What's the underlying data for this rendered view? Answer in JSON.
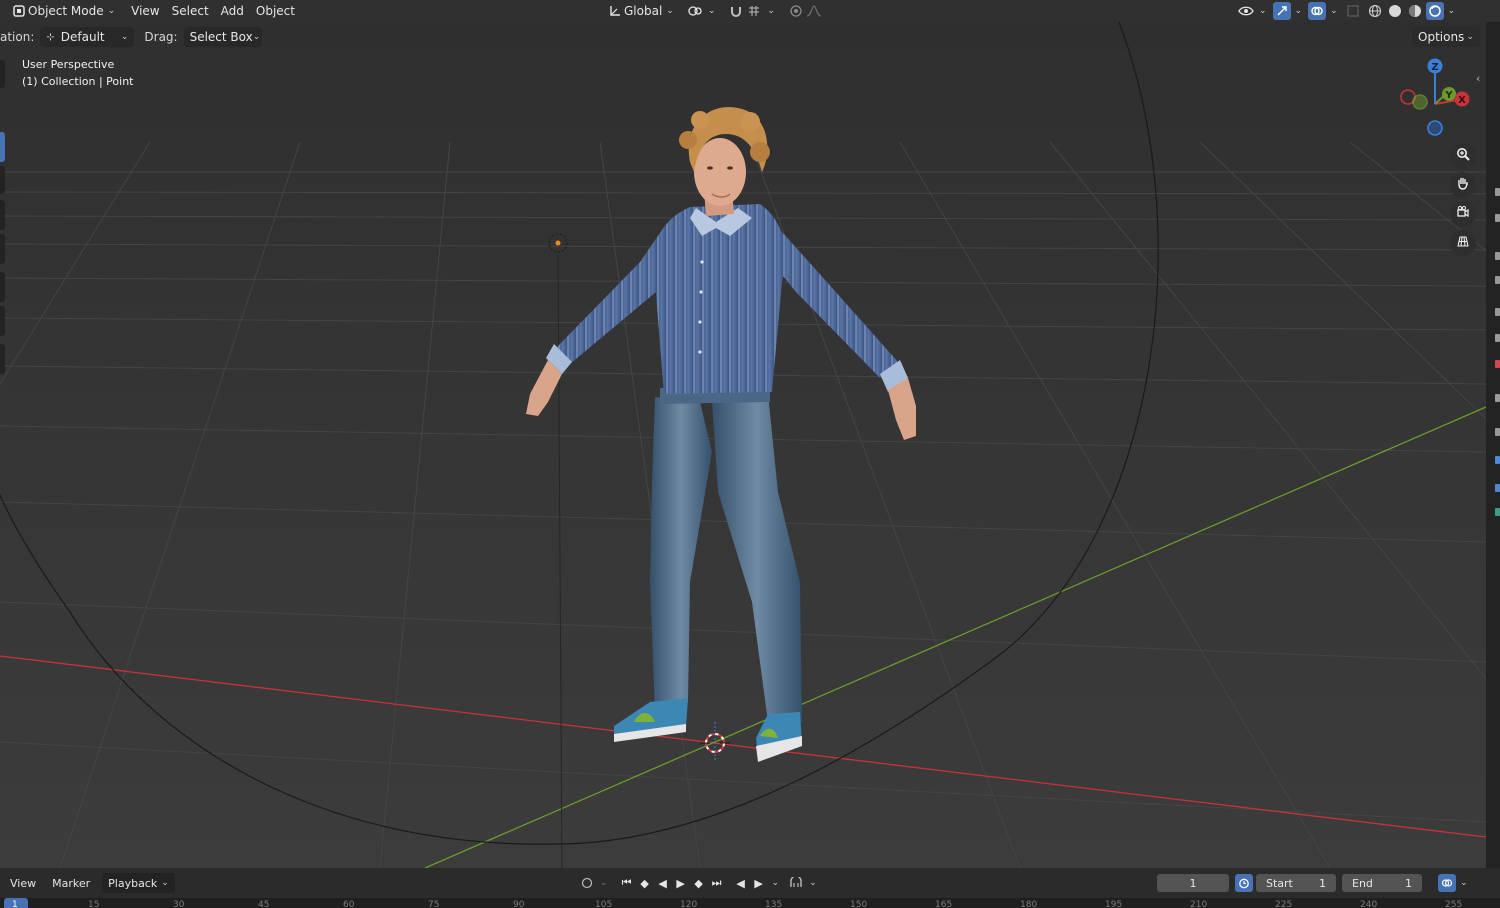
{
  "header": {
    "mode": "Object Mode",
    "menus": [
      "View",
      "Select",
      "Add",
      "Object"
    ],
    "orientation": "Global"
  },
  "tool_settings": {
    "orientation_label": "ation:",
    "orientation_value": "Default",
    "drag_label": "Drag:",
    "drag_value": "Select Box",
    "options": "Options"
  },
  "viewport": {
    "perspective": "User Perspective",
    "collection": "(1) Collection | Point"
  },
  "gizmo": {
    "z": "Z",
    "y": "Y",
    "x": "X"
  },
  "timeline": {
    "menus": [
      "View",
      "Marker",
      "Playback"
    ],
    "current_frame": "1",
    "start_label": "Start",
    "start_value": "1",
    "end_label": "End",
    "end_value": "1",
    "ruler_ticks": [
      "1",
      "15",
      "30",
      "45",
      "60",
      "75",
      "90",
      "105",
      "120",
      "135",
      "150",
      "165",
      "180",
      "195",
      "210",
      "225",
      "240",
      "255"
    ]
  },
  "colors": {
    "x_axis": "#c8323a",
    "y_axis": "#6a9b2b",
    "z_axis": "#3d7ed8",
    "accent": "#4772b3",
    "grid": "#434343"
  },
  "icons": {
    "mode": "object-mode-icon",
    "transform_orientation": "axis-icon",
    "pivot": "pivot-icon",
    "snap": "magnet-icon",
    "proportional": "proportional-edit-icon",
    "visibility": "eye-icon",
    "gizmo": "gizmo-icon",
    "overlay": "overlay-icon",
    "shading": "shading-icons",
    "zoom": "zoom-icon",
    "pan": "hand-icon",
    "camera": "camera-icon",
    "ortho": "grid-view-icon"
  }
}
